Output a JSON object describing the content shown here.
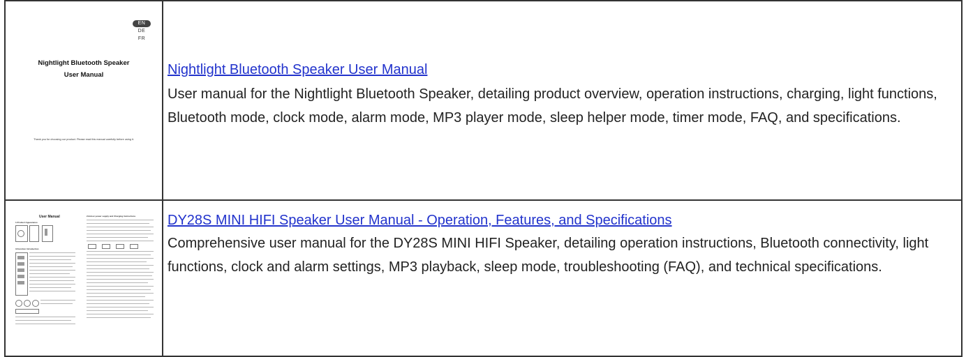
{
  "results": [
    {
      "title": "Nightlight Bluetooth Speaker User Manual",
      "description": "User manual for the Nightlight Bluetooth Speaker, detailing product overview, operation instructions, charging, light functions, Bluetooth mode, clock mode, alarm mode, MP3 player mode, sleep helper mode, timer mode, FAQ, and specifications.",
      "thumbnail": {
        "languages": [
          "EN",
          "DE",
          "FR"
        ],
        "title_line1": "Nightlight Bluetooth Speaker",
        "title_line2": "User Manual",
        "note": "Thank you for choosing our product. Please read this manual carefully before using it."
      }
    },
    {
      "title": "DY28S MINI HIFI Speaker User Manual - Operation, Features, and Specifications",
      "description": "Comprehensive user manual for the DY28S MINI HIFI Speaker, detailing operation instructions, Bluetooth connectivity, light functions, clock and alarm settings, MP3 playback, sleep mode, troubleshooting (FAQ), and technical specifications.",
      "thumbnail": {
        "title": "User Manual",
        "section_1": "1.Product Appearance",
        "section_2": "2.Indoor power supply and Charging Instructions",
        "section_3": "3.Function Introduction"
      }
    }
  ]
}
